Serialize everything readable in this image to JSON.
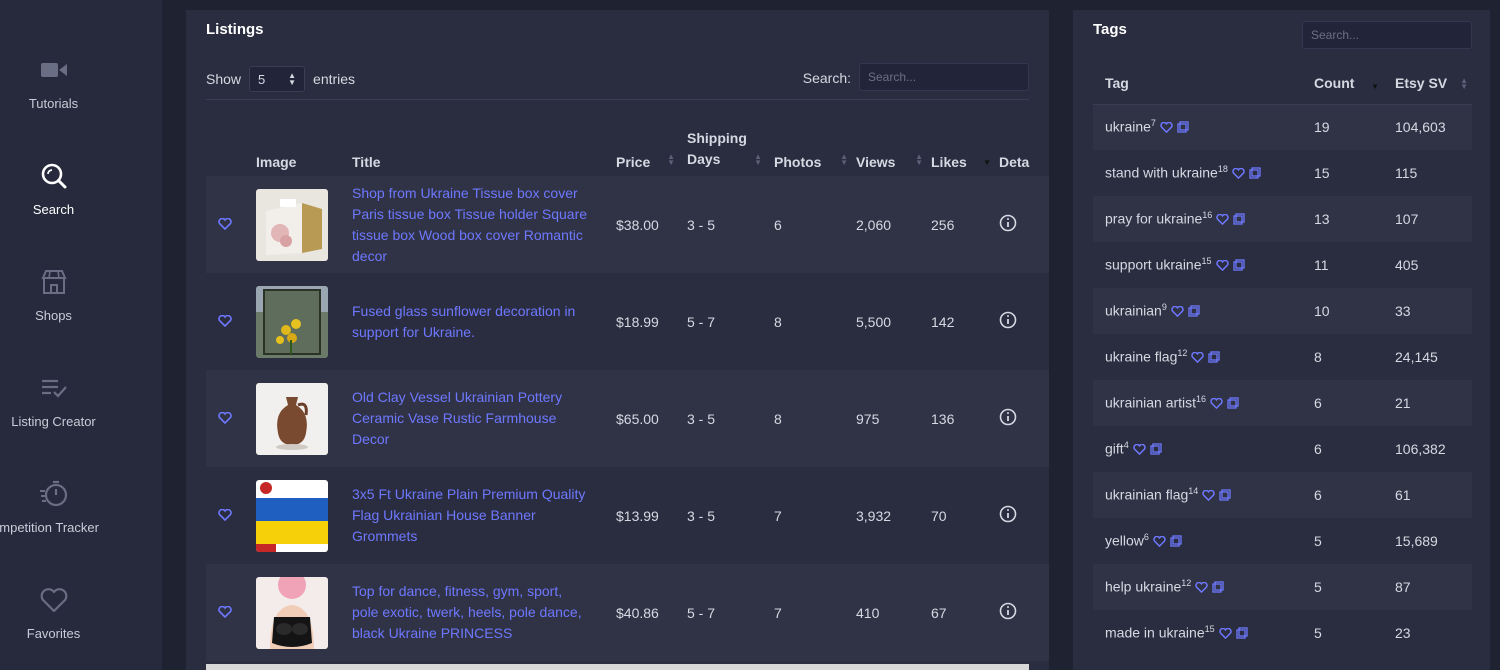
{
  "sidebar": {
    "items": [
      {
        "label": "Tutorials",
        "icon": "video-camera-icon",
        "active": false
      },
      {
        "label": "Search",
        "icon": "search-icon",
        "active": true
      },
      {
        "label": "Shops",
        "icon": "store-icon",
        "active": false
      },
      {
        "label": "Listing Creator",
        "icon": "list-check-icon",
        "active": false
      },
      {
        "label": "ompetition Tracker",
        "icon": "stopwatch-icon",
        "active": false
      },
      {
        "label": "Favorites",
        "icon": "heart-icon",
        "active": false
      }
    ]
  },
  "listings": {
    "title": "Listings",
    "show_label": "Show",
    "entries_value": "5",
    "entries_label": "entries",
    "search_label": "Search:",
    "search_placeholder": "Search...",
    "columns": [
      "Image",
      "Title",
      "Price",
      "Shipping Days",
      "Photos",
      "Views",
      "Likes",
      "Deta"
    ],
    "rows": [
      {
        "title": "Shop from Ukraine Tissue box cover Paris tissue box Tissue holder Square tissue box Wood box cover Romantic decor",
        "price": "$38.00",
        "shipping": "3 - 5",
        "photos": "6",
        "views": "2,060",
        "likes": "256",
        "thumb": "tissue-box"
      },
      {
        "title": "Fused glass sunflower decoration in support for Ukraine.",
        "price": "$18.99",
        "shipping": "5 - 7",
        "photos": "8",
        "views": "5,500",
        "likes": "142",
        "thumb": "sunflower-glass"
      },
      {
        "title": "Old Clay Vessel Ukrainian Pottery Ceramic Vase Rustic Farmhouse Decor",
        "price": "$65.00",
        "shipping": "3 - 5",
        "photos": "8",
        "views": "975",
        "likes": "136",
        "thumb": "clay-vase"
      },
      {
        "title": "3x5 Ft Ukraine Plain Premium Quality Flag Ukrainian House Banner Grommets",
        "price": "$13.99",
        "shipping": "3 - 5",
        "photos": "7",
        "views": "3,932",
        "likes": "70",
        "thumb": "ukraine-flag"
      },
      {
        "title": "Top for dance, fitness, gym, sport, pole exotic, twerk, heels, pole dance, black Ukraine PRINCESS",
        "price": "$40.86",
        "shipping": "5 - 7",
        "photos": "7",
        "views": "410",
        "likes": "67",
        "thumb": "dance-top"
      }
    ]
  },
  "tags": {
    "title": "Tags",
    "search_placeholder": "Search...",
    "columns": [
      "Tag",
      "Count",
      "Etsy SV"
    ],
    "rows": [
      {
        "tag": "ukraine",
        "sup": "7",
        "count": "19",
        "sv": "104,603"
      },
      {
        "tag": "stand with ukraine",
        "sup": "18",
        "count": "15",
        "sv": "115"
      },
      {
        "tag": "pray for ukraine",
        "sup": "16",
        "count": "13",
        "sv": "107"
      },
      {
        "tag": "support ukraine",
        "sup": "15",
        "count": "11",
        "sv": "405"
      },
      {
        "tag": "ukrainian",
        "sup": "9",
        "count": "10",
        "sv": "33"
      },
      {
        "tag": "ukraine flag",
        "sup": "12",
        "count": "8",
        "sv": "24,145"
      },
      {
        "tag": "ukrainian artist",
        "sup": "16",
        "count": "6",
        "sv": "21"
      },
      {
        "tag": "gift",
        "sup": "4",
        "count": "6",
        "sv": "106,382"
      },
      {
        "tag": "ukrainian flag",
        "sup": "14",
        "count": "6",
        "sv": "61"
      },
      {
        "tag": "yellow",
        "sup": "6",
        "count": "5",
        "sv": "15,689"
      },
      {
        "tag": "help ukraine",
        "sup": "12",
        "count": "5",
        "sv": "87"
      },
      {
        "tag": "made in ukraine",
        "sup": "15",
        "count": "5",
        "sv": "23"
      }
    ]
  },
  "colors": {
    "background": "#1f2231",
    "panel": "#2a2d3f",
    "row_alt": "#303346",
    "accent_link": "#6e78ff"
  }
}
